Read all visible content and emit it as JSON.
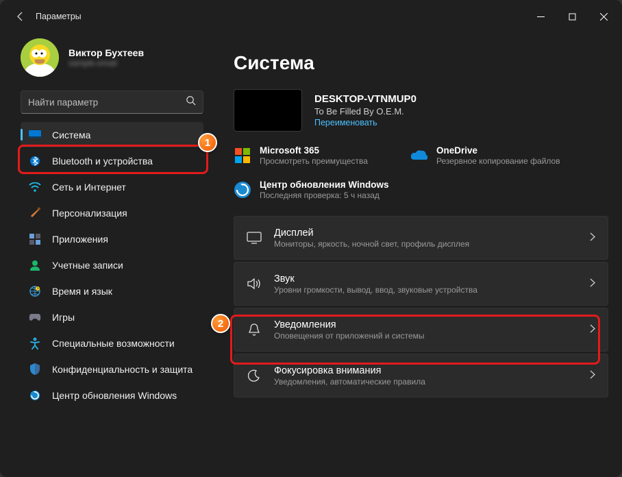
{
  "window": {
    "title": "Параметры"
  },
  "profile": {
    "name": "Виктор Бухтеев",
    "email": "sample.email"
  },
  "search": {
    "placeholder": "Найти параметр"
  },
  "nav": [
    {
      "key": "system",
      "label": "Система",
      "active": true
    },
    {
      "key": "bluetooth",
      "label": "Bluetooth и устройства"
    },
    {
      "key": "network",
      "label": "Сеть и Интернет"
    },
    {
      "key": "personalization",
      "label": "Персонализация"
    },
    {
      "key": "apps",
      "label": "Приложения"
    },
    {
      "key": "accounts",
      "label": "Учетные записи"
    },
    {
      "key": "time",
      "label": "Время и язык"
    },
    {
      "key": "gaming",
      "label": "Игры"
    },
    {
      "key": "accessibility",
      "label": "Специальные возможности"
    },
    {
      "key": "privacy",
      "label": "Конфиденциальность и защита"
    },
    {
      "key": "update",
      "label": "Центр обновления Windows"
    }
  ],
  "page": {
    "title": "Система"
  },
  "device": {
    "name": "DESKTOP-VTNMUP0",
    "model": "To Be Filled By O.E.M.",
    "rename": "Переименовать"
  },
  "tiles": {
    "m365": {
      "title": "Microsoft 365",
      "desc": "Просмотреть преимущества"
    },
    "onedrive": {
      "title": "OneDrive",
      "desc": "Резервное копирование файлов"
    }
  },
  "wu": {
    "title": "Центр обновления Windows",
    "desc": "Последняя проверка: 5 ч назад"
  },
  "cards": {
    "display": {
      "title": "Дисплей",
      "desc": "Мониторы, яркость, ночной свет, профиль дисплея"
    },
    "sound": {
      "title": "Звук",
      "desc": "Уровни громкости, вывод, ввод, звуковые устройства"
    },
    "notifications": {
      "title": "Уведомления",
      "desc": "Оповещения от приложений и системы"
    },
    "focus": {
      "title": "Фокусировка внимания",
      "desc": "Уведомления, автоматические правила"
    }
  },
  "annotations": {
    "one": "1",
    "two": "2"
  }
}
